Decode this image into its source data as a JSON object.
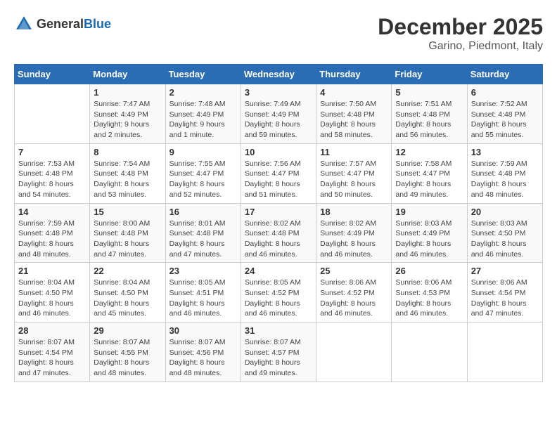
{
  "header": {
    "logo_general": "General",
    "logo_blue": "Blue",
    "title": "December 2025",
    "location": "Garino, Piedmont, Italy"
  },
  "calendar": {
    "days_of_week": [
      "Sunday",
      "Monday",
      "Tuesday",
      "Wednesday",
      "Thursday",
      "Friday",
      "Saturday"
    ],
    "weeks": [
      [
        {
          "day": "",
          "sunrise": "",
          "sunset": "",
          "daylight": ""
        },
        {
          "day": "1",
          "sunrise": "Sunrise: 7:47 AM",
          "sunset": "Sunset: 4:49 PM",
          "daylight": "Daylight: 9 hours and 2 minutes."
        },
        {
          "day": "2",
          "sunrise": "Sunrise: 7:48 AM",
          "sunset": "Sunset: 4:49 PM",
          "daylight": "Daylight: 9 hours and 1 minute."
        },
        {
          "day": "3",
          "sunrise": "Sunrise: 7:49 AM",
          "sunset": "Sunset: 4:49 PM",
          "daylight": "Daylight: 8 hours and 59 minutes."
        },
        {
          "day": "4",
          "sunrise": "Sunrise: 7:50 AM",
          "sunset": "Sunset: 4:48 PM",
          "daylight": "Daylight: 8 hours and 58 minutes."
        },
        {
          "day": "5",
          "sunrise": "Sunrise: 7:51 AM",
          "sunset": "Sunset: 4:48 PM",
          "daylight": "Daylight: 8 hours and 56 minutes."
        },
        {
          "day": "6",
          "sunrise": "Sunrise: 7:52 AM",
          "sunset": "Sunset: 4:48 PM",
          "daylight": "Daylight: 8 hours and 55 minutes."
        }
      ],
      [
        {
          "day": "7",
          "sunrise": "Sunrise: 7:53 AM",
          "sunset": "Sunset: 4:48 PM",
          "daylight": "Daylight: 8 hours and 54 minutes."
        },
        {
          "day": "8",
          "sunrise": "Sunrise: 7:54 AM",
          "sunset": "Sunset: 4:48 PM",
          "daylight": "Daylight: 8 hours and 53 minutes."
        },
        {
          "day": "9",
          "sunrise": "Sunrise: 7:55 AM",
          "sunset": "Sunset: 4:47 PM",
          "daylight": "Daylight: 8 hours and 52 minutes."
        },
        {
          "day": "10",
          "sunrise": "Sunrise: 7:56 AM",
          "sunset": "Sunset: 4:47 PM",
          "daylight": "Daylight: 8 hours and 51 minutes."
        },
        {
          "day": "11",
          "sunrise": "Sunrise: 7:57 AM",
          "sunset": "Sunset: 4:47 PM",
          "daylight": "Daylight: 8 hours and 50 minutes."
        },
        {
          "day": "12",
          "sunrise": "Sunrise: 7:58 AM",
          "sunset": "Sunset: 4:47 PM",
          "daylight": "Daylight: 8 hours and 49 minutes."
        },
        {
          "day": "13",
          "sunrise": "Sunrise: 7:59 AM",
          "sunset": "Sunset: 4:48 PM",
          "daylight": "Daylight: 8 hours and 48 minutes."
        }
      ],
      [
        {
          "day": "14",
          "sunrise": "Sunrise: 7:59 AM",
          "sunset": "Sunset: 4:48 PM",
          "daylight": "Daylight: 8 hours and 48 minutes."
        },
        {
          "day": "15",
          "sunrise": "Sunrise: 8:00 AM",
          "sunset": "Sunset: 4:48 PM",
          "daylight": "Daylight: 8 hours and 47 minutes."
        },
        {
          "day": "16",
          "sunrise": "Sunrise: 8:01 AM",
          "sunset": "Sunset: 4:48 PM",
          "daylight": "Daylight: 8 hours and 47 minutes."
        },
        {
          "day": "17",
          "sunrise": "Sunrise: 8:02 AM",
          "sunset": "Sunset: 4:48 PM",
          "daylight": "Daylight: 8 hours and 46 minutes."
        },
        {
          "day": "18",
          "sunrise": "Sunrise: 8:02 AM",
          "sunset": "Sunset: 4:49 PM",
          "daylight": "Daylight: 8 hours and 46 minutes."
        },
        {
          "day": "19",
          "sunrise": "Sunrise: 8:03 AM",
          "sunset": "Sunset: 4:49 PM",
          "daylight": "Daylight: 8 hours and 46 minutes."
        },
        {
          "day": "20",
          "sunrise": "Sunrise: 8:03 AM",
          "sunset": "Sunset: 4:50 PM",
          "daylight": "Daylight: 8 hours and 46 minutes."
        }
      ],
      [
        {
          "day": "21",
          "sunrise": "Sunrise: 8:04 AM",
          "sunset": "Sunset: 4:50 PM",
          "daylight": "Daylight: 8 hours and 46 minutes."
        },
        {
          "day": "22",
          "sunrise": "Sunrise: 8:04 AM",
          "sunset": "Sunset: 4:50 PM",
          "daylight": "Daylight: 8 hours and 45 minutes."
        },
        {
          "day": "23",
          "sunrise": "Sunrise: 8:05 AM",
          "sunset": "Sunset: 4:51 PM",
          "daylight": "Daylight: 8 hours and 46 minutes."
        },
        {
          "day": "24",
          "sunrise": "Sunrise: 8:05 AM",
          "sunset": "Sunset: 4:52 PM",
          "daylight": "Daylight: 8 hours and 46 minutes."
        },
        {
          "day": "25",
          "sunrise": "Sunrise: 8:06 AM",
          "sunset": "Sunset: 4:52 PM",
          "daylight": "Daylight: 8 hours and 46 minutes."
        },
        {
          "day": "26",
          "sunrise": "Sunrise: 8:06 AM",
          "sunset": "Sunset: 4:53 PM",
          "daylight": "Daylight: 8 hours and 46 minutes."
        },
        {
          "day": "27",
          "sunrise": "Sunrise: 8:06 AM",
          "sunset": "Sunset: 4:54 PM",
          "daylight": "Daylight: 8 hours and 47 minutes."
        }
      ],
      [
        {
          "day": "28",
          "sunrise": "Sunrise: 8:07 AM",
          "sunset": "Sunset: 4:54 PM",
          "daylight": "Daylight: 8 hours and 47 minutes."
        },
        {
          "day": "29",
          "sunrise": "Sunrise: 8:07 AM",
          "sunset": "Sunset: 4:55 PM",
          "daylight": "Daylight: 8 hours and 48 minutes."
        },
        {
          "day": "30",
          "sunrise": "Sunrise: 8:07 AM",
          "sunset": "Sunset: 4:56 PM",
          "daylight": "Daylight: 8 hours and 48 minutes."
        },
        {
          "day": "31",
          "sunrise": "Sunrise: 8:07 AM",
          "sunset": "Sunset: 4:57 PM",
          "daylight": "Daylight: 8 hours and 49 minutes."
        },
        {
          "day": "",
          "sunrise": "",
          "sunset": "",
          "daylight": ""
        },
        {
          "day": "",
          "sunrise": "",
          "sunset": "",
          "daylight": ""
        },
        {
          "day": "",
          "sunrise": "",
          "sunset": "",
          "daylight": ""
        }
      ]
    ]
  }
}
